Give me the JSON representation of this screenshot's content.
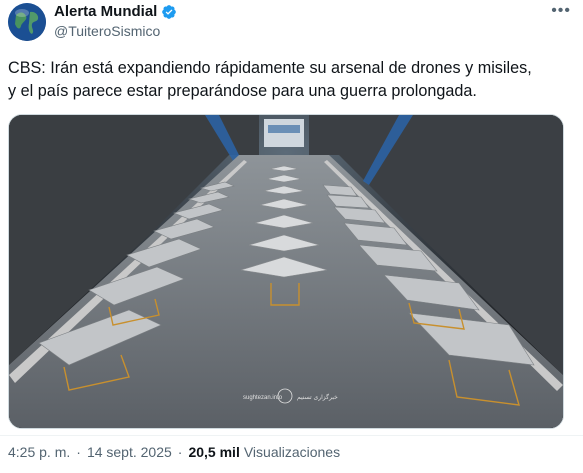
{
  "author": {
    "name": "Alerta Mundial",
    "handle": "@TuiteroSismico",
    "avatar_icon": "globe-icon",
    "verified_icon": "verified-badge-icon",
    "verified_color": "#1d9bf0"
  },
  "menu": {
    "more_label": "•••"
  },
  "tweet": {
    "line1": "CBS: Irán está expandiendo rápidamente su arsenal de drones y misiles,",
    "line2": "y el país parece estar preparándose para una guerra prolongada."
  },
  "media": {
    "description_icon": "photo-drones-tunnel",
    "watermark_left": "sughtezan.info",
    "watermark_right": "خبرگزاری تسنیم"
  },
  "meta": {
    "time": "4:25 p. m.",
    "separator": "·",
    "date": "14 sept. 2025",
    "views_count": "20,5 mil",
    "views_label": "Visualizaciones"
  }
}
